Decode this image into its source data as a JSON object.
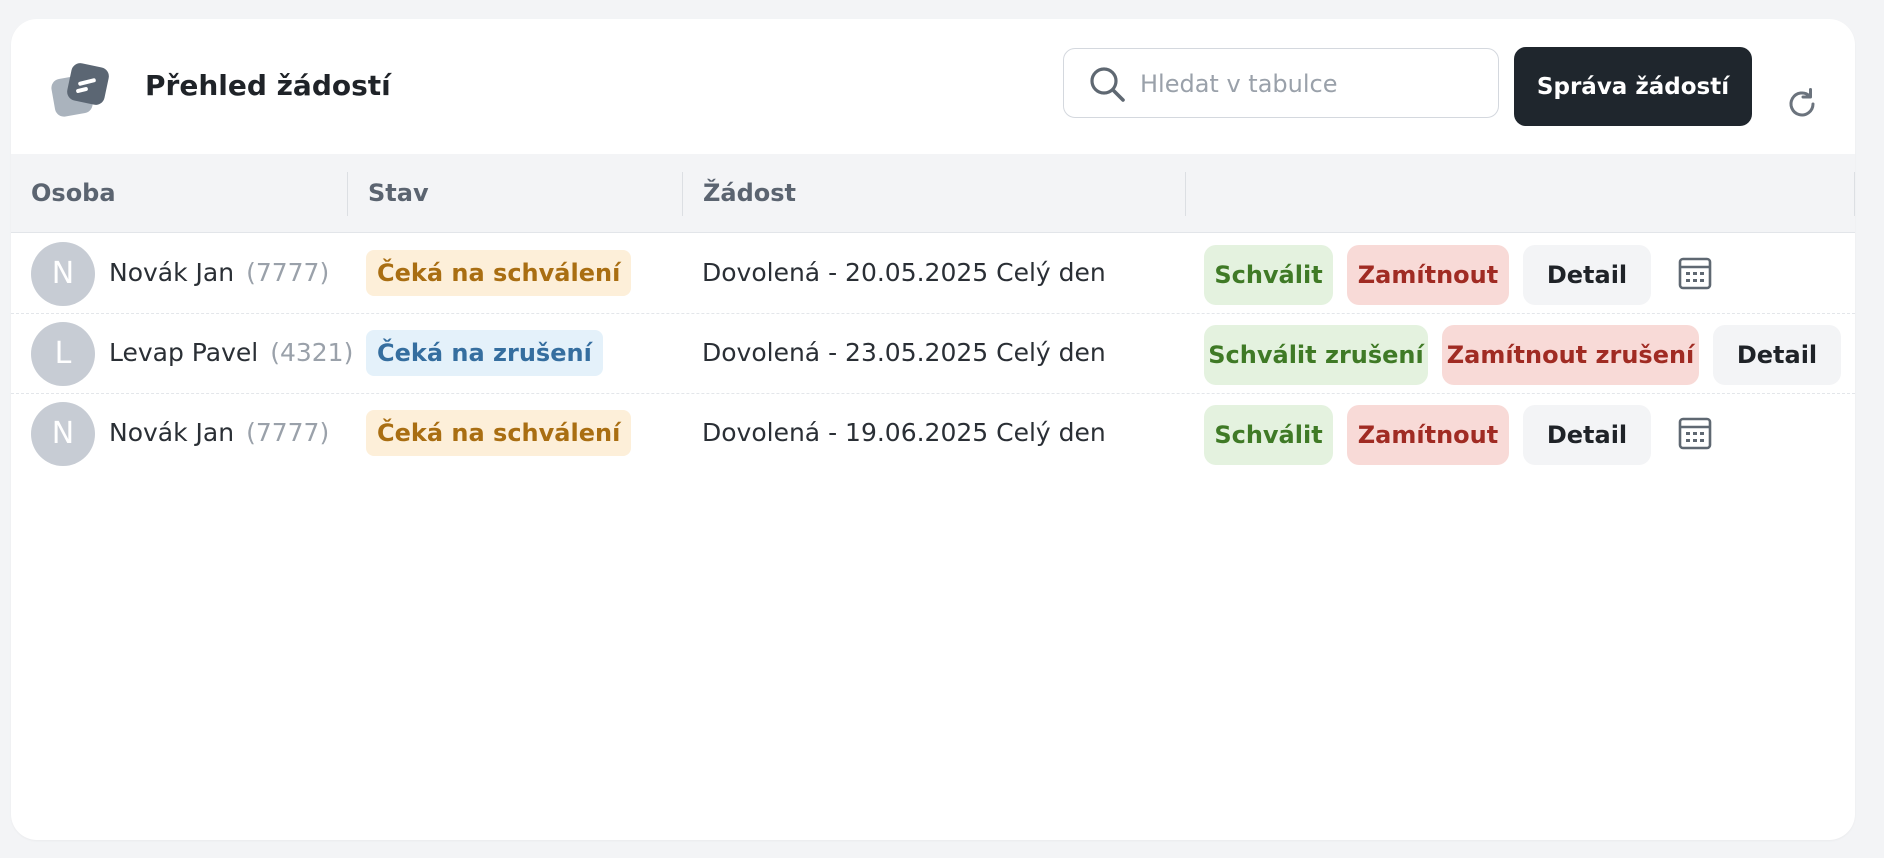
{
  "header": {
    "title": "Přehled žádostí",
    "logo_icon": "documents-icon",
    "search_placeholder": "Hledat v tabulce",
    "search_value": "",
    "manage_button_label": "Správa žádostí",
    "refresh_icon": "refresh-icon"
  },
  "table": {
    "columns": [
      "Osoba",
      "Stav",
      "Žádost",
      ""
    ],
    "rows": [
      {
        "avatar_letter": "N",
        "name": "Novák Jan",
        "id": "(7777)",
        "status": "Čeká na schválení",
        "request": "Dovolená - 20.05.2025 Celý den",
        "approve_label": "Schválit",
        "reject_label": "Zamítnout",
        "detail_label": "Detail",
        "calendar_icon": "calendar-icon"
      },
      {
        "avatar_letter": "L",
        "name": "Levap Pavel",
        "id": "(4321)",
        "status": "Čeká na zrušení",
        "request": "Dovolená - 23.05.2025 Celý den",
        "approve_label": "Schválit zrušení",
        "reject_label": "Zamítnout zrušení",
        "detail_label": "Detail"
      },
      {
        "avatar_letter": "N",
        "name": "Novák Jan",
        "id": "(7777)",
        "status": "Čeká na schválení",
        "request": "Dovolená - 19.06.2025 Celý den",
        "approve_label": "Schválit",
        "reject_label": "Zamítnout",
        "detail_label": "Detail",
        "calendar_icon": "calendar-icon"
      }
    ]
  },
  "colors": {
    "pending_badge_bg": "#fdefd9",
    "pending_badge_text": "#a96e12",
    "cancel_badge_bg": "#e4f1fa",
    "cancel_badge_text": "#356e9f",
    "approve_bg": "#e4f2df",
    "reject_bg": "#f8dad7",
    "primary_button": "#1f262d"
  }
}
